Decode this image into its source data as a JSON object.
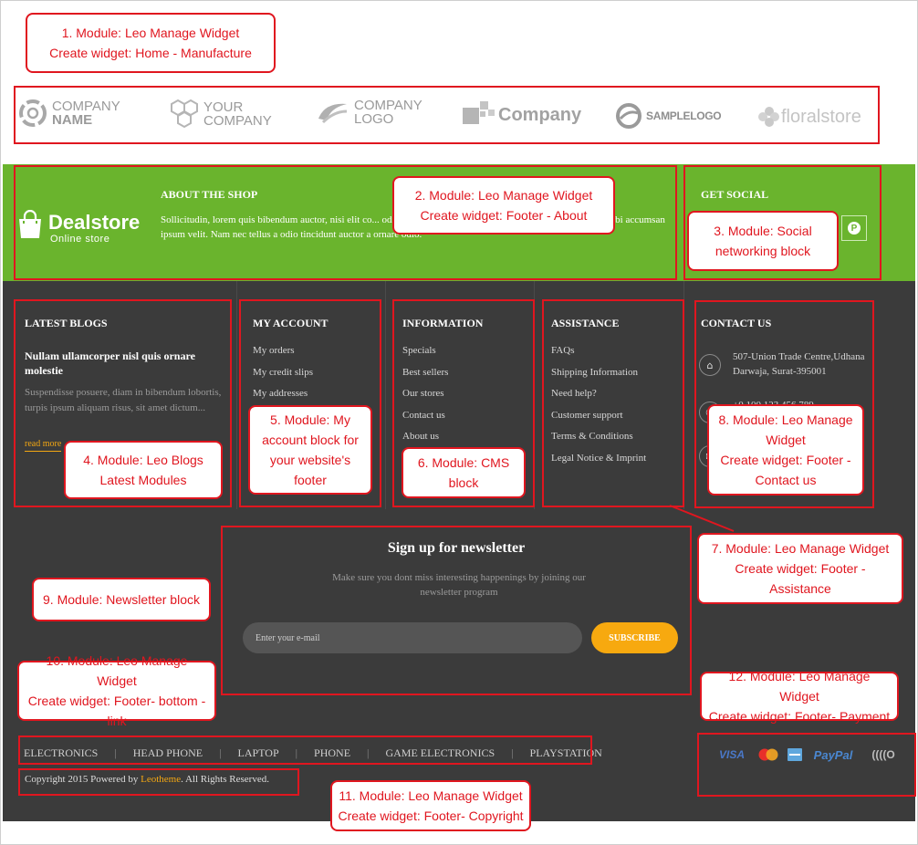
{
  "annotations": {
    "a1": {
      "line1": "1. Module: Leo Manage Widget",
      "line2": "Create widget: Home - Manufacture"
    },
    "a2": {
      "line1": "2. Module: Leo Manage Widget",
      "line2": "Create widget: Footer - About"
    },
    "a3": {
      "line1": "3. Module: Social",
      "line2": "networking block"
    },
    "a4": {
      "line1": "4. Module: Leo Blogs",
      "line2": "Latest Modules"
    },
    "a5": {
      "line1": "5. Module: My",
      "line2": "account block for",
      "line3": "your website's",
      "line4": "footer"
    },
    "a6": {
      "line1": "6. Module: CMS",
      "line2": "block"
    },
    "a7": {
      "line1": "7. Module: Leo Manage Widget",
      "line2": "Create widget: Footer -",
      "line3": "Assistance"
    },
    "a8": {
      "line1": "8. Module: Leo Manage",
      "line2": "Widget",
      "line3": "Create widget: Footer -",
      "line4": "Contact us"
    },
    "a9": {
      "line1": "9. Module: Newsletter block"
    },
    "a10": {
      "line1": "10. Module: Leo Manage Widget",
      "line2": "Create widget: Footer- bottom -",
      "line3": "link"
    },
    "a11": {
      "line1": "11. Module: Leo Manage Widget",
      "line2": "Create widget: Footer- Copyright"
    },
    "a12": {
      "line1": "12. Module: Leo Manage Widget",
      "line2": "Create widget: Footer- Payment"
    }
  },
  "manufacturers": [
    {
      "line1": "COMPANY",
      "line2": "NAME",
      "icon": "ring-logo-icon"
    },
    {
      "line1": "YOUR",
      "line2": "COMPANY",
      "icon": "hexagon-logo-icon"
    },
    {
      "line1": "COMPANY",
      "line2": "LOGO",
      "icon": "swoosh-logo-icon"
    },
    {
      "line1": "Company",
      "icon": "puzzle-logo-icon"
    },
    {
      "line1": "SAMPLELOGO",
      "icon": "circle-logo-icon"
    },
    {
      "line1": "floralstore",
      "icon": "flower-logo-icon"
    }
  ],
  "brand": {
    "name": "Dealstore",
    "tagline": "Online store"
  },
  "about": {
    "title": "ABOUT THE SHOP",
    "text": "Sollicitudin, lorem quis bibendum auctor, nisi elit co... odio sit amet nibh vulputate cursus a sit amet mauris. Morbi accumsan ipsum velit. Nam nec tellus a odio tincidunt auctor a ornare odio."
  },
  "social": {
    "title": "GET SOCIAL",
    "icon": "pinterest-icon",
    "glyph": "P"
  },
  "blogs": {
    "title": "LATEST BLOGS",
    "post_title": "Nullam ullamcorper nisl quis ornare molestie",
    "summary": "Suspendisse posuere, diam in bibendum lobortis, turpis ipsum aliquam risus, sit amet dictum...",
    "read_more": "read more"
  },
  "my_account": {
    "title": "MY ACCOUNT",
    "items": [
      "My orders",
      "My credit slips",
      "My addresses"
    ]
  },
  "information": {
    "title": "INFORMATION",
    "items": [
      "Specials",
      "Best sellers",
      "Our stores",
      "Contact us",
      "About us"
    ]
  },
  "assistance": {
    "title": "ASSISTANCE",
    "items": [
      "FAQs",
      "Shipping Information",
      "Need help?",
      "Customer support",
      "Terms & Conditions",
      "Legal Notice & Imprint"
    ]
  },
  "contact": {
    "title": "CONTACT US",
    "address": "507-Union Trade Centre,Udhana Darwaja, Surat-395001",
    "phone": "+0 100 123 456 789"
  },
  "newsletter": {
    "title": "Sign up for newsletter",
    "subtitle": "Make sure you dont miss interesting happenings by joining our newsletter program",
    "placeholder": "Enter your e-mail",
    "button": "SUBSCRIBE"
  },
  "bottom_links": [
    "ELECTRONICS",
    "HEAD PHONE",
    "LAPTOP",
    "PHONE",
    "GAME ELECTRONICS",
    "PLAYSTATION"
  ],
  "copyright": {
    "prefix": "Copyright 2015 Powered by ",
    "link": "Leotheme",
    "suffix": ". All Rights Reserved."
  },
  "payments": [
    {
      "label": "VISA",
      "icon": "visa-icon"
    },
    {
      "label": "",
      "icon": "mastercard-icon"
    },
    {
      "label": "",
      "icon": "amex-icon"
    },
    {
      "label": "PayPal",
      "icon": "paypal-icon"
    },
    {
      "label": "((((O",
      "icon": "contactless-icon"
    }
  ],
  "colors": {
    "green": "#6ab42d",
    "dark": "#3b3b3b",
    "accent": "#f7a90f",
    "annotation_red": "#e0161f"
  }
}
